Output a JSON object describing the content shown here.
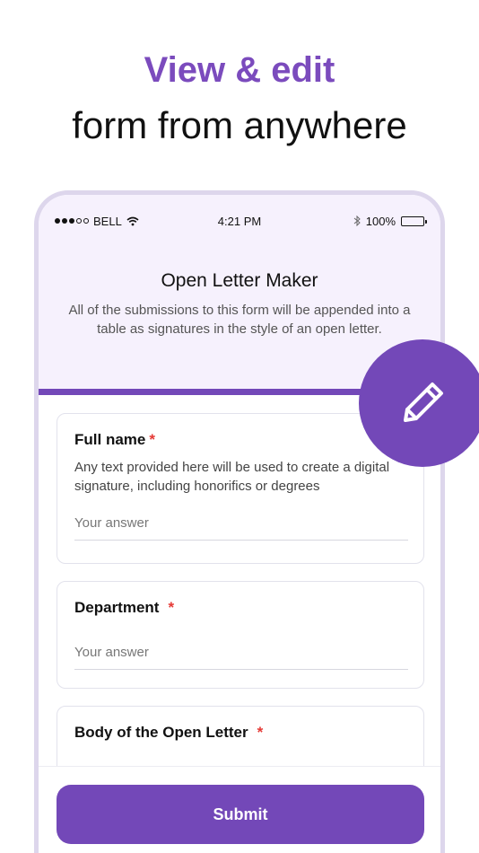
{
  "headline": {
    "accent": "View & edit",
    "sub": "form from anywhere"
  },
  "status_bar": {
    "carrier": "BELL",
    "time": "4:21 PM",
    "battery": "100%"
  },
  "form": {
    "title": "Open Letter Maker",
    "description": "All of the submissions to this form will be appended into a table as signatures in the style of an open letter.",
    "questions": [
      {
        "title": "Full name",
        "required_mark": "*",
        "help": "Any text provided here will be used to create a digital signature, including honorifics or degrees",
        "placeholder": "Your answer"
      },
      {
        "title": "Department",
        "required_mark": "*",
        "placeholder": "Your answer"
      },
      {
        "title": "Body of the Open Letter",
        "required_mark": "*"
      }
    ],
    "submit_label": "Submit"
  },
  "colors": {
    "accent": "#7348b8",
    "headline_accent": "#7b4bbd",
    "header_bg": "#f6f1fd",
    "required": "#e53935"
  },
  "icons": {
    "fab": "pencil-icon"
  }
}
